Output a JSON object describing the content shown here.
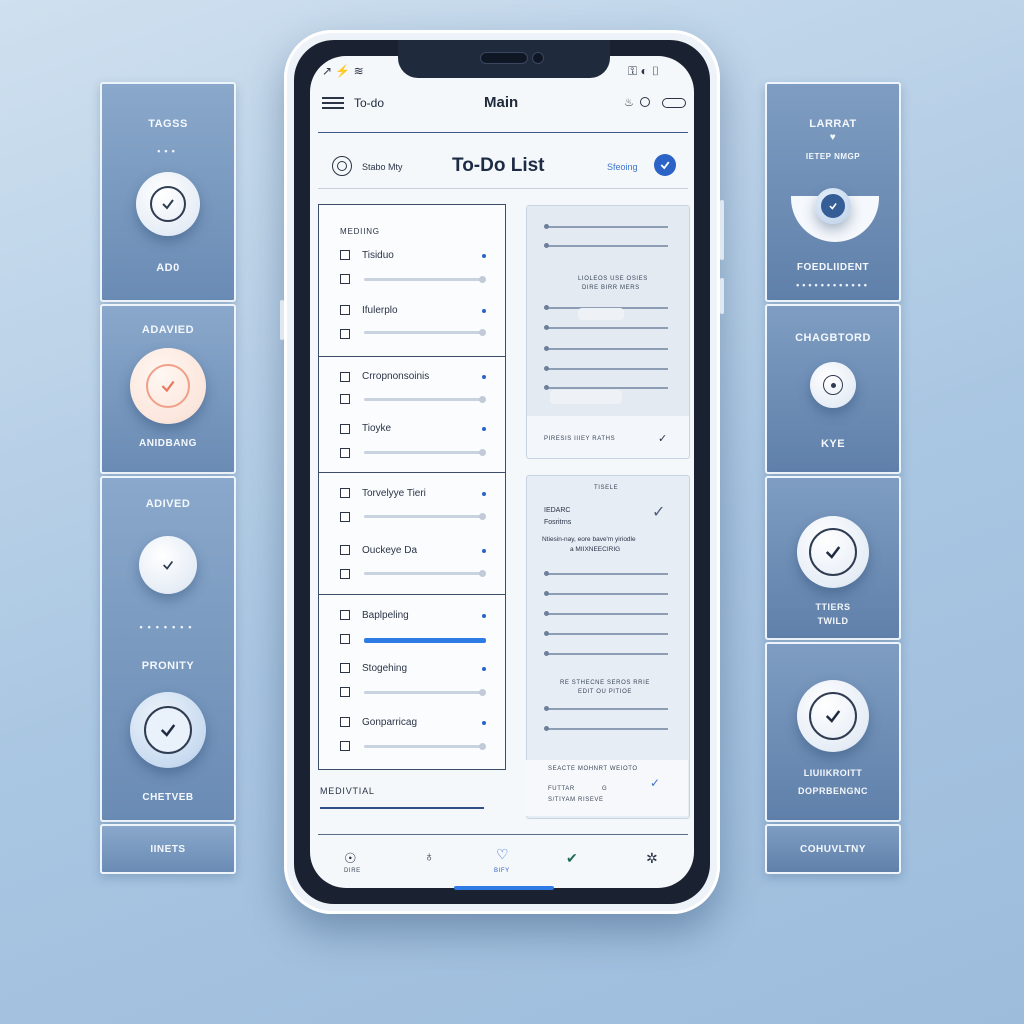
{
  "left_panels": [
    {
      "top_label": "TAGSS",
      "bottom_label": "AD0"
    },
    {
      "top_label": "ADAVIED",
      "bottom_label": "ANIDBANG"
    },
    {
      "top_label": "ADIVED",
      "middle_label": "PRONITY",
      "bottom_label": "CHETVEB"
    },
    {
      "label": "IINETS"
    }
  ],
  "right_panels": [
    {
      "top_label": "LARRAT",
      "sub_label": "IETEP NMGP",
      "bottom_label": "FOEDLIIDENT"
    },
    {
      "top_label": "CHAGBTORD",
      "bottom_label": "KYE"
    },
    {
      "top_label": "TTIERS",
      "bottom_label": "TWILD"
    },
    {
      "top_label": "LIUIIKROITT",
      "bottom_label": "DOPRBENGNC"
    },
    {
      "label": "COHUVLTNY"
    }
  ],
  "status_bar": {
    "left_icons": "↗ ⚡ ≋",
    "right_icons": "⚿ ◐ ▯"
  },
  "app_header": {
    "left_title": "To-do",
    "center_title": "Main"
  },
  "list_header": {
    "left_text": "Stabo Mty",
    "title": "To-Do List",
    "status_text": "Sfeoing"
  },
  "groups": [
    {
      "heading": "MEDIING",
      "items": [
        "Tisiduo",
        "Ifulerplo"
      ]
    },
    {
      "items": [
        "Crropnonsoinis",
        "Tioyke"
      ]
    },
    {
      "items": [
        "Torvelyye Tieri",
        "Ouckeye Da"
      ]
    },
    {
      "items": [
        "Baplpeling",
        "Stogehing",
        "Gonparricag"
      ]
    }
  ],
  "footer_label": "MEDIVTIAL",
  "right_top_panel": {
    "caption1": "LIOLEOS USE OSIES",
    "caption2": "DIRE BIRR MERS",
    "footer": "PIRESIS IIIEY RATHS"
  },
  "right_mid_panel": {
    "title": "TISELE",
    "line1": "IEDARC",
    "line2": "Fosritrns",
    "line3": "Ntiesin-nay, eore bave'm yiriodle",
    "line4": "a MIIXNEECIRIG",
    "caption1": "RE STHECNE SEROS RRIE",
    "caption2": "EDIT OU PITIOE",
    "footer1": "SEACTE MOHNRT WEIOTO",
    "footer2": "FUTTAR",
    "footer3": "S/TIYAM RISEVE",
    "footer_mark": "G"
  },
  "bottom_nav": [
    {
      "icon": "home-icon",
      "glyph": "☉",
      "label": "DIRE"
    },
    {
      "icon": "lightbulb-icon",
      "glyph": "♁",
      "label": ""
    },
    {
      "icon": "heart-icon",
      "glyph": "♡",
      "label": "BIFY"
    },
    {
      "icon": "check-icon",
      "glyph": "✔",
      "label": ""
    },
    {
      "icon": "settings-icon",
      "glyph": "✲",
      "label": ""
    }
  ],
  "colors": {
    "accent": "#2b63c7",
    "panel": "#6a8bb4",
    "background": "#b3cde6"
  }
}
